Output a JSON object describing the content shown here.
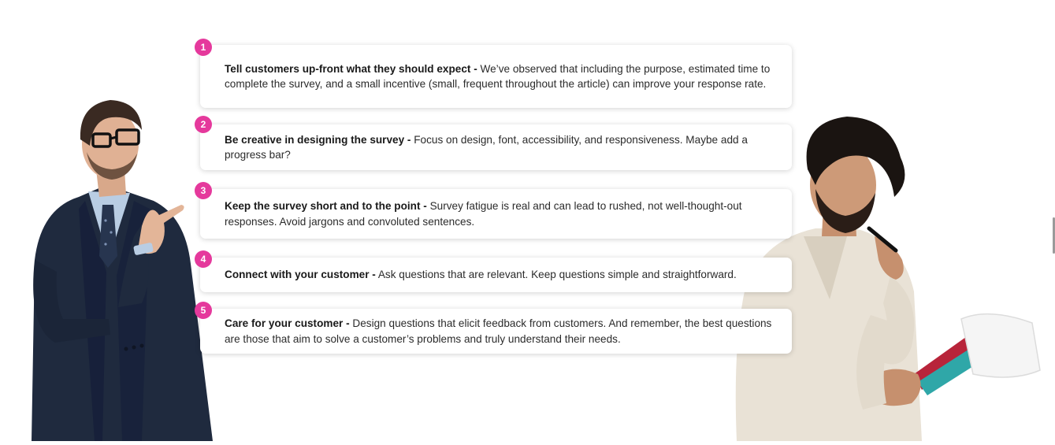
{
  "tips": [
    {
      "number": "1",
      "title": "Tell customers up-front what they should expect -",
      "body": " We’ve observed that including the purpose, estimated time to complete the survey, and a small incentive (small, frequent throughout the article) can improve your response rate."
    },
    {
      "number": "2",
      "title": "Be creative in designing the survey -",
      "body": " Focus on design, font, accessibility, and responsiveness. Maybe add a progress bar?"
    },
    {
      "number": "3",
      "title": "Keep the survey short and to the point -",
      "body": " Survey fatigue is real and can lead to rushed, not well-thought-out responses. Avoid jargons and convoluted sentences."
    },
    {
      "number": "4",
      "title": "Connect with your customer -",
      "body": " Ask questions that are relevant. Keep questions simple and straightforward."
    },
    {
      "number": "5",
      "title": "Care for your customer -",
      "body": " Design questions that elicit feedback from customers. And remember, the best questions are those that aim to solve a customer’s problems and truly understand their needs."
    }
  ],
  "colors": {
    "badge": "#e5399c",
    "suit": "#1f2a3e",
    "shirt_right": "#e9e2d6"
  },
  "illustrations": {
    "left": "businessman-pointing",
    "right": "man-thinking-with-notebook"
  }
}
